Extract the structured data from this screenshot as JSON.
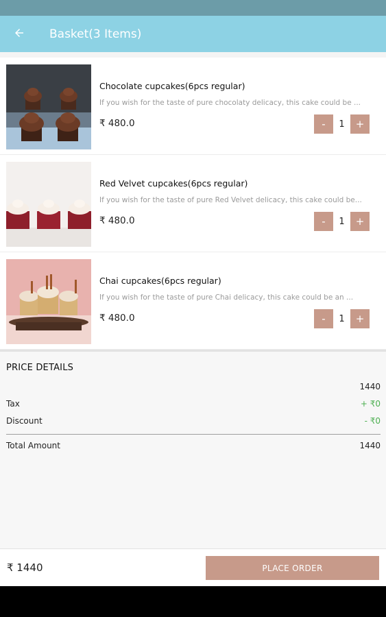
{
  "app_bar": {
    "title": "Basket(3 Items)"
  },
  "items": [
    {
      "name": "Chocolate cupcakes(6pcs regular)",
      "description": "If you wish for the taste of pure chocolaty delicacy, this cake could be ...",
      "price": "₹ 480.0",
      "quantity": "1",
      "minus": "-",
      "plus": "+"
    },
    {
      "name": "Red Velvet cupcakes(6pcs regular)",
      "description": "If you wish for the taste of pure Red Velvet delicacy, this cake could be...",
      "price": "₹ 480.0",
      "quantity": "1",
      "minus": "-",
      "plus": "+"
    },
    {
      "name": "Chai cupcakes(6pcs regular)",
      "description": "If you wish for the taste of pure Chai delicacy, this cake could be an ...",
      "price": "₹ 480.0",
      "quantity": "1",
      "minus": "-",
      "plus": "+"
    }
  ],
  "price_details": {
    "title": "PRICE DETAILS",
    "subtotal": "1440",
    "tax_label": "Tax",
    "tax_value": "+ ₹0",
    "discount_label": "Discount",
    "discount_value": "- ₹0",
    "total_label": "Total Amount",
    "total_value": "1440"
  },
  "bottom_bar": {
    "total": "₹ 1440",
    "place_order": "PLACE ORDER"
  },
  "colors": {
    "status_bar": "#6c9ca8",
    "app_bar": "#8dd2e4",
    "accent": "#c79a8a",
    "positive": "#4caf50"
  },
  "icons": {
    "back": "arrow-left-icon"
  }
}
